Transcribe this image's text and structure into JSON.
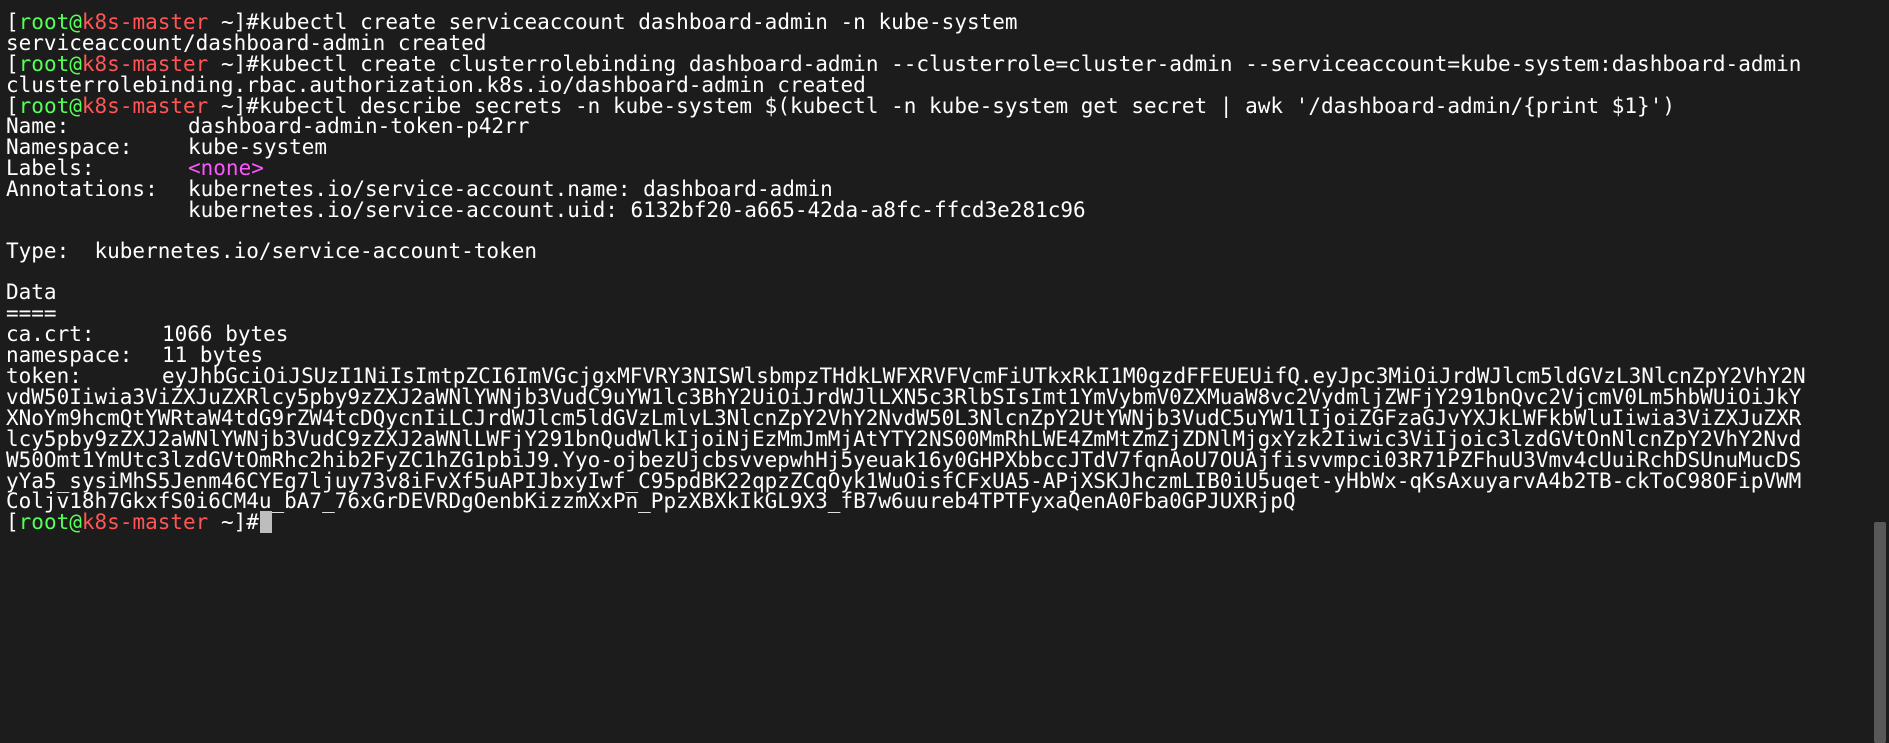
{
  "prompt": {
    "user": "root",
    "at": "@",
    "host": "k8s-master",
    "path": "~",
    "symbol": "#"
  },
  "commands": {
    "cmd1": "kubectl create serviceaccount dashboard-admin -n kube-system",
    "out1": "serviceaccount/dashboard-admin created",
    "cmd2": "kubectl create clusterrolebinding dashboard-admin --clusterrole=cluster-admin --serviceaccount=kube-system:dashboard-admin",
    "out2": "clusterrolebinding.rbac.authorization.k8s.io/dashboard-admin created",
    "cmd3": "kubectl describe secrets -n kube-system $(kubectl -n kube-system get secret | awk '/dashboard-admin/{print $1}')"
  },
  "secret": {
    "name_label": "Name:",
    "name_value": "dashboard-admin-token-p42rr",
    "namespace_label": "Namespace:",
    "namespace_value": "kube-system",
    "labels_label": "Labels:",
    "labels_value": "<none>",
    "annotations_label": "Annotations:",
    "annotation_1": "kubernetes.io/service-account.name: dashboard-admin",
    "annotation_2": "kubernetes.io/service-account.uid: 6132bf20-a665-42da-a8fc-ffcd3e281c96",
    "type_line": "Type:  kubernetes.io/service-account-token",
    "data_heading": "Data",
    "data_rule": "====",
    "cacrt_label": "ca.crt:",
    "cacrt_value": "1066 bytes",
    "ns_label": "namespace:",
    "ns_value": "11 bytes",
    "token_label": "token:",
    "token_lines": [
      "eyJhbGciOiJSUzI1NiIsImtpZCI6ImVGcjgxMFVRY3NISWlsbmpzTHdkLWFXRVFVcmFiUTkxRkI1M0gzdFFEUEUifQ.eyJpc3MiOiJrdWJlcm5ldGVzL3NlcnZpY2VhY2N",
      "vdW50Iiwia3ViZXJuZXRlcy5pby9zZXJ2aWNlYWNjb3VudC9uYW1lc3BhY2UiOiJrdWJlLXN5c3RlbSIsImt1YmVybmV0ZXMuaW8vc2VydmljZWFjY291bnQvc2VjcmV0Lm5hbWUiOiJkY",
      "XNoYm9hcmQtYWRtaW4tdG9rZW4tcDQycnIiLCJrdWJlcm5ldGVzLmlvL3NlcnZpY2VhY2NvdW50L3NlcnZpY2UtYWNjb3VudC5uYW1lIjoiZGFzaGJvYXJkLWFkbWluIiwia3ViZXJuZXR",
      "lcy5pby9zZXJ2aWNlYWNjb3VudC9zZXJ2aWNlLWFjY291bnQudWlkIjoiNjEzMmJmMjAtYTY2NS00MmRhLWE4ZmMtZmZjZDNlMjgxYzk2Iiwic3ViIjoic3lzdGVtOnNlcnZpY2VhY2Nvd",
      "W50Omt1YmUtc3lzdGVtOmRhc2hib2FyZC1hZG1pbiJ9.Yyo-ojbezUjcbsvvepwhHj5yeuak16y0GHPXbbccJTdV7fqnAoU7OUAjfisvvmpci03R71PZFhuU3Vmv4cUuiRchDSUnuMucDS",
      "yYa5_sysiMhS5Jenm46CYEg7ljuy73v8iFvXf5uAPIJbxyIwf_C95pdBK22qpzZCqOyk1WuOisfCFxUA5-APjXSKJhczmLIB0iU5uqet-yHbWx-qKsAxuyarvA4b2TB-ckToC98OFipVWM",
      "Coljv18h7GkxfS0i6CM4u_bA7_76xGrDEVRDgOenbKizzmXxPn_PpzXBXkIkGL9X3_fB7w6uureb4TPTFyxaQenA0Fba0GPJUXRjpQ"
    ]
  },
  "colors": {
    "background": "#1c1c1c",
    "text": "#ffffff",
    "prompt_user": "#55ff55",
    "prompt_host": "#ff5555",
    "none_value": "#ff55ff",
    "cursor": "#bdbdbd",
    "scroll_thumb": "#585858"
  }
}
